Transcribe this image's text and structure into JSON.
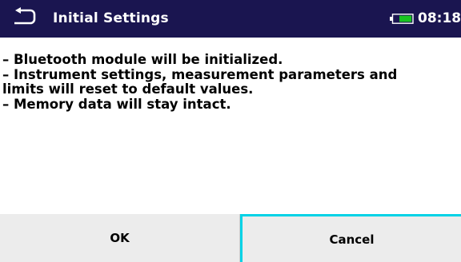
{
  "header": {
    "title": "Initial Settings",
    "time": "08:18",
    "back_icon": "return-arrow-icon",
    "battery_icon": "battery-icon",
    "colors": {
      "background": "#1a1550",
      "battery_fill": "#18c420"
    }
  },
  "message": {
    "lines": [
      "– Bluetooth module will be initialized.",
      "– Instrument settings, measurement parameters and",
      "limits will reset to default values.",
      "– Memory data will stay intact."
    ]
  },
  "buttons": {
    "ok_label": "OK",
    "cancel_label": "Cancel",
    "selected": "Cancel",
    "selected_color": "#00d2e6"
  }
}
